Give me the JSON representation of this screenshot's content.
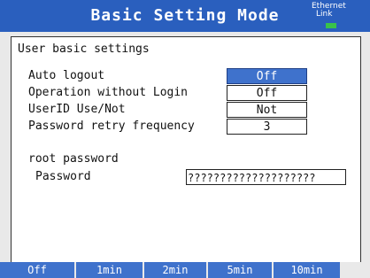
{
  "header": {
    "title": "Basic Setting Mode",
    "ethernet_line1": "Ethernet",
    "ethernet_line2": "Link",
    "link_color": "#39c24b",
    "accent_color": "#2a5fbe"
  },
  "section": {
    "title": "User basic settings"
  },
  "settings": [
    {
      "label": "Auto logout",
      "value": "Off"
    },
    {
      "label": "Operation without Login",
      "value": "Off"
    },
    {
      "label": "UserID Use/Not",
      "value": "Not"
    },
    {
      "label": "Password retry frequency",
      "value": "3"
    }
  ],
  "root": {
    "title": "root password",
    "password_label": "Password",
    "password_value": "????????????????????"
  },
  "softkeys": [
    "Off",
    "1min",
    "2min",
    "5min",
    "10min"
  ]
}
